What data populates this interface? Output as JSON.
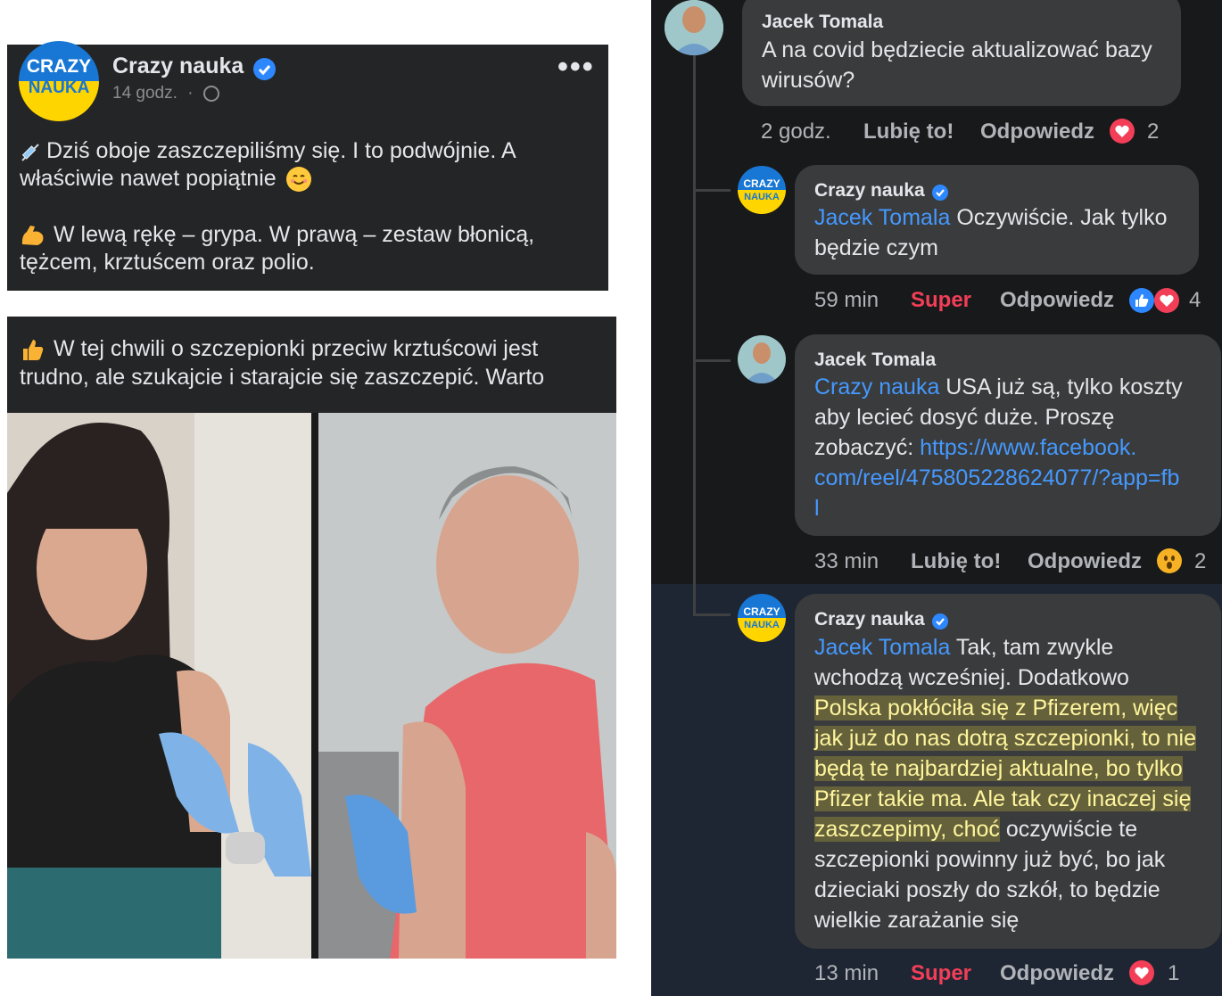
{
  "post": {
    "author": "Crazy nauka",
    "time": "14 godz.",
    "separator": "·",
    "menu": "•••",
    "line1": "Dziś oboje zaszczepiliśmy się. I to podwójnie. A",
    "line2": "właściwie nawet popiątnie",
    "line3": "W lewą rękę – grypa. W prawą – zestaw błonicą,",
    "line4": "tężcem, krztuścem oraz polio.",
    "logo_top": "CRAZY",
    "logo_bottom": "NAUKA"
  },
  "image_post": {
    "line1": "W tej chwili o szczepionki przeciw krztuścowi jest",
    "line2": "trudno, ale szukajcie i starajcie się zaszczepić. Warto"
  },
  "comments": [
    {
      "author": "Jacek Tomala",
      "text1": "A na covid będziecie aktualizować bazy",
      "text2": "wirusów?",
      "time": "2 godz.",
      "like": "Lubię to!",
      "reply": "Odpowiedz",
      "reactions": "2"
    },
    {
      "author": "Crazy nauka",
      "mention": "Jacek Tomala",
      "text1": " Oczywiście. Jak tylko",
      "text2": "będzie czym",
      "time": "59 min",
      "like": "Super",
      "reply": "Odpowiedz",
      "reactions": "4"
    },
    {
      "author": "Jacek Tomala",
      "mention": "Crazy nauka",
      "text1": " USA już są,  tylko koszty",
      "text2": "aby lecieć dosyć duże. Proszę",
      "text3": "zobaczyć: ",
      "link1": "https://www.facebook.",
      "link2": "com/reel/475805228624077/?app=fb",
      "link3": "l",
      "time": "33 min",
      "like": "Lubię to!",
      "reply": "Odpowiedz",
      "reactions": "2"
    },
    {
      "author": "Crazy nauka",
      "mention": "Jacek Tomala",
      "text1": " Tak, tam zwykle",
      "text2": "wchodzą wcześniej. Dodatkowo",
      "hl1": "Polska pokłóciła się z Pfizerem, więc",
      "hl2": "jak już do nas dotrą szczepionki, to nie",
      "hl3": "będą te najbardziej aktualne, bo tylko",
      "hl4": "Pfizer takie ma. Ale tak czy inaczej się",
      "hl5": "zaszczepimy, choć",
      "text3": " oczywiście te",
      "text4": "szczepionki powinny już być, bo jak",
      "text5": "dzieciaki poszły do szkół, to będzie",
      "text6": "wielkie zarażanie się",
      "time": "13 min",
      "like": "Super",
      "reply": "Odpowiedz",
      "reactions": "1"
    }
  ],
  "colors": {
    "card_bg": "#242526",
    "panel_bg": "#18191a",
    "bubble_bg": "#3a3b3c",
    "mention": "#4599ff",
    "super": "#f33e58",
    "verified": "#2d88ff",
    "logo_blue": "#1877d4",
    "logo_yellow": "#ffd500"
  },
  "icons": [
    "verified-badge-icon",
    "globe-icon",
    "more-icon",
    "syringe-emoji",
    "smile-emoji",
    "flexed-biceps-emoji",
    "thumbs-up-emoji",
    "heart-reaction-icon",
    "like-reaction-icon",
    "wow-reaction-icon"
  ]
}
